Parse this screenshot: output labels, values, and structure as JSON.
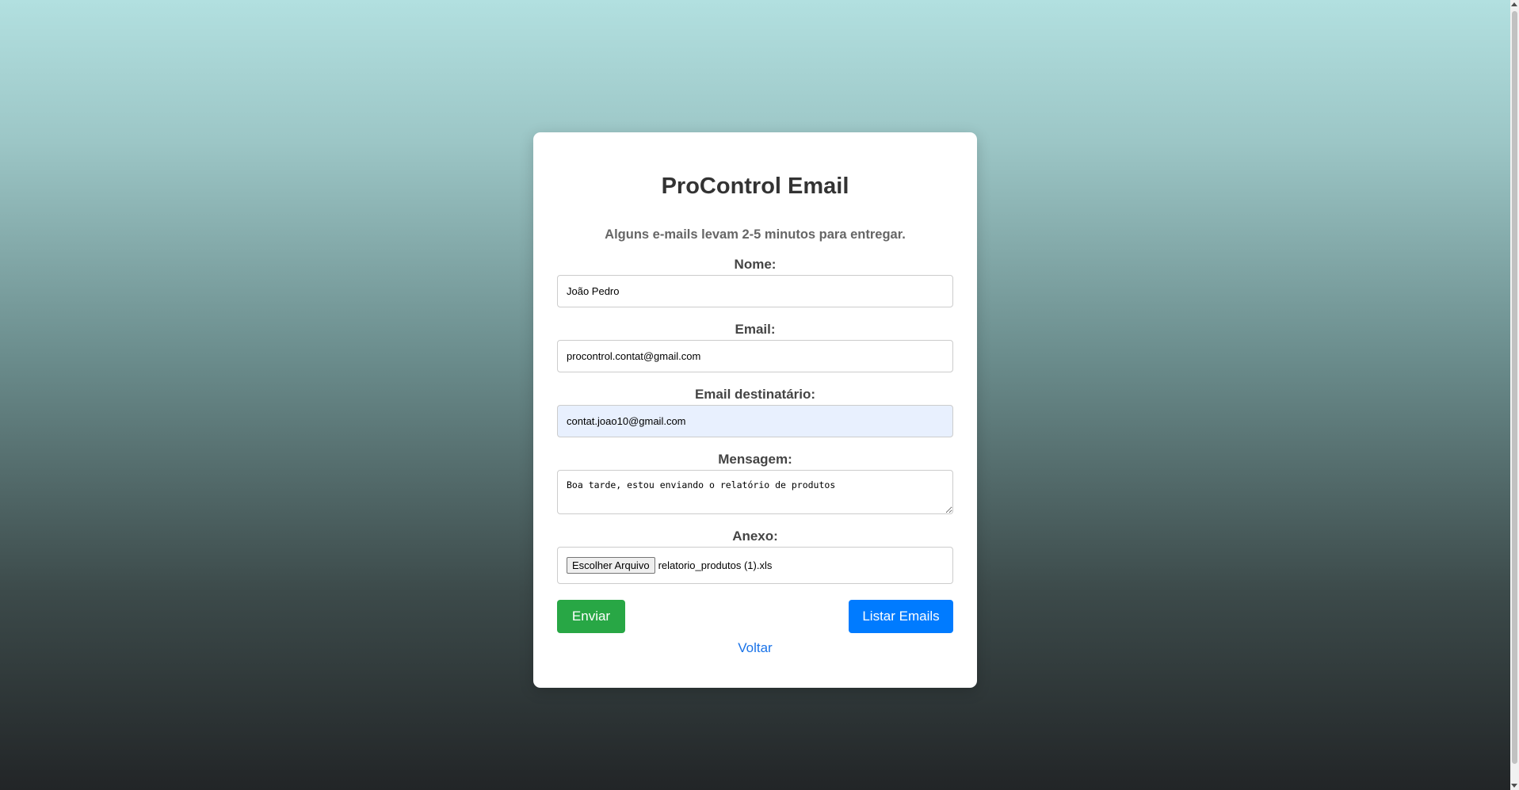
{
  "form": {
    "title": "ProControl Email",
    "subtitle": "Alguns e-mails levam 2-5 minutos para entregar.",
    "fields": {
      "nome": {
        "label": "Nome:",
        "value": "João Pedro"
      },
      "email": {
        "label": "Email:",
        "value": "procontrol.contat@gmail.com"
      },
      "destinatario": {
        "label": "Email destinatário:",
        "value": "contat.joao10@gmail.com"
      },
      "mensagem": {
        "label": "Mensagem:",
        "value": "Boa tarde, estou enviando o relatório de produtos"
      },
      "anexo": {
        "label": "Anexo:",
        "button_label": "Escolher Arquivo",
        "file_name": "relatorio_produtos (1).xls"
      }
    },
    "buttons": {
      "send_label": "Enviar",
      "list_label": "Listar Emails"
    },
    "back_link": "Voltar"
  },
  "colors": {
    "send_button": "#28a745",
    "list_button": "#007bff",
    "link": "#1a73e8",
    "autofill_bg": "#e8f0fe"
  }
}
